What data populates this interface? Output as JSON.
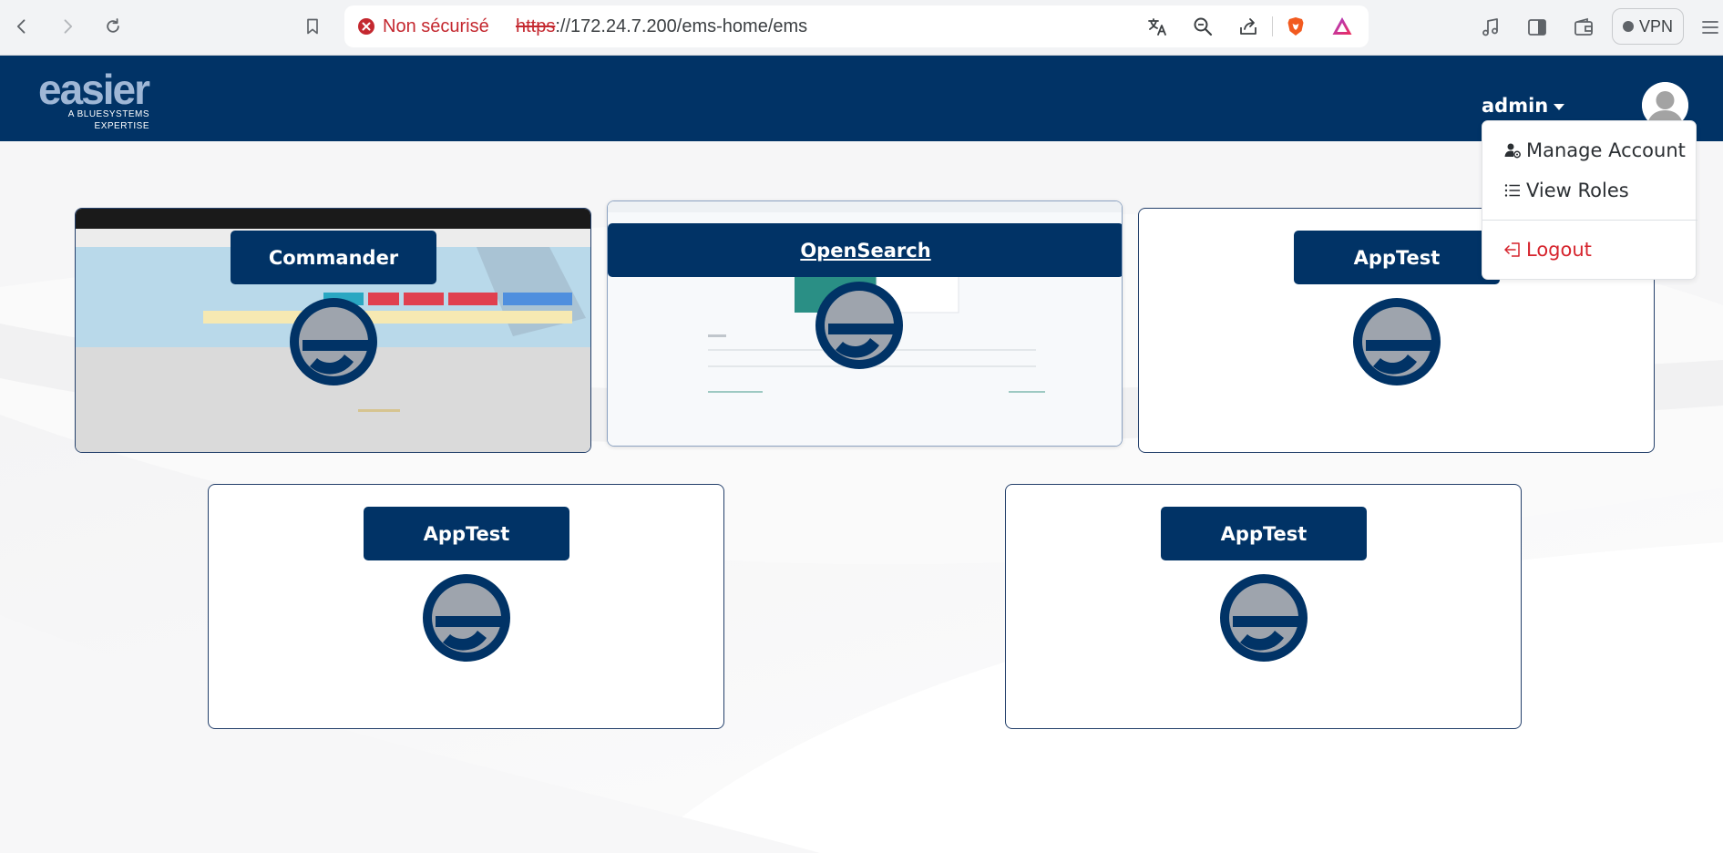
{
  "browser": {
    "security_label": "Non sécurisé",
    "url_scheme": "https",
    "url_rest": "://172.24.7.200/ems-home/ems",
    "vpn_label": "VPN",
    "icons": [
      "back-icon",
      "forward-icon",
      "reload-icon",
      "bookmark-icon",
      "not-secure-icon",
      "translate-icon",
      "zoom-icon",
      "share-icon",
      "brave-shields-icon",
      "brave-rewards-icon",
      "music-icon",
      "sidebar-icon",
      "wallet-icon",
      "menu-icon"
    ]
  },
  "header": {
    "logo_text": "easier",
    "logo_sub_line1": "A BLUESYSTEMS",
    "logo_sub_line2": "EXPERTISE",
    "username": "admin",
    "brand_color": "#013366"
  },
  "user_menu": {
    "items": [
      {
        "label": "Manage Account",
        "icon": "user-gear-icon"
      },
      {
        "label": "View Roles",
        "icon": "list-icon"
      },
      {
        "label": "Logout",
        "icon": "logout-icon"
      }
    ],
    "logout_color": "#d6242d"
  },
  "apps": [
    {
      "title": "Commander",
      "preview": "blurred-commander-screenshot"
    },
    {
      "title": "OpenSearch",
      "preview": "blurred-opensearch-screenshot"
    },
    {
      "title": "AppTest",
      "preview": "none"
    },
    {
      "title": "AppTest",
      "preview": "none"
    },
    {
      "title": "AppTest",
      "preview": "none"
    }
  ]
}
